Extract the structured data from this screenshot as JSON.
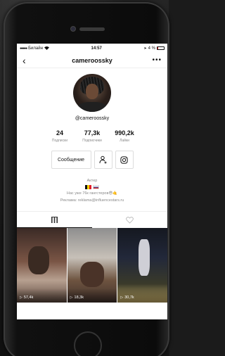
{
  "statusbar": {
    "carrier": "Билайн",
    "time": "14:57",
    "battery": "4 %"
  },
  "navbar": {
    "title": "cameroossky",
    "more_label": "•••"
  },
  "profile": {
    "handle": "@cameroossky",
    "stats": [
      {
        "value": "24",
        "label": "Подписки"
      },
      {
        "value": "77,3k",
        "label": "Подписчики"
      },
      {
        "value": "990,2k",
        "label": "Лайки"
      }
    ],
    "message_button": "Сообщение",
    "bio": {
      "line1": "Актер",
      "line2": "Нас уже 76к гангстеров😎🤙",
      "line3": "Реклама: reklama@influencestars.ru"
    }
  },
  "videos": [
    {
      "views": "57,4k"
    },
    {
      "views": "18,3k"
    },
    {
      "views": "30,7k"
    }
  ],
  "colors": {
    "battery_low": "#e02020",
    "text_secondary": "#8a8a8a"
  },
  "icons": {
    "back": "chevron-left-icon",
    "more": "more-horizontal-icon",
    "add_friend": "add-user-icon",
    "instagram": "instagram-icon",
    "grid_tab": "grid-icon",
    "liked_tab": "heart-icon",
    "play": "play-icon"
  }
}
